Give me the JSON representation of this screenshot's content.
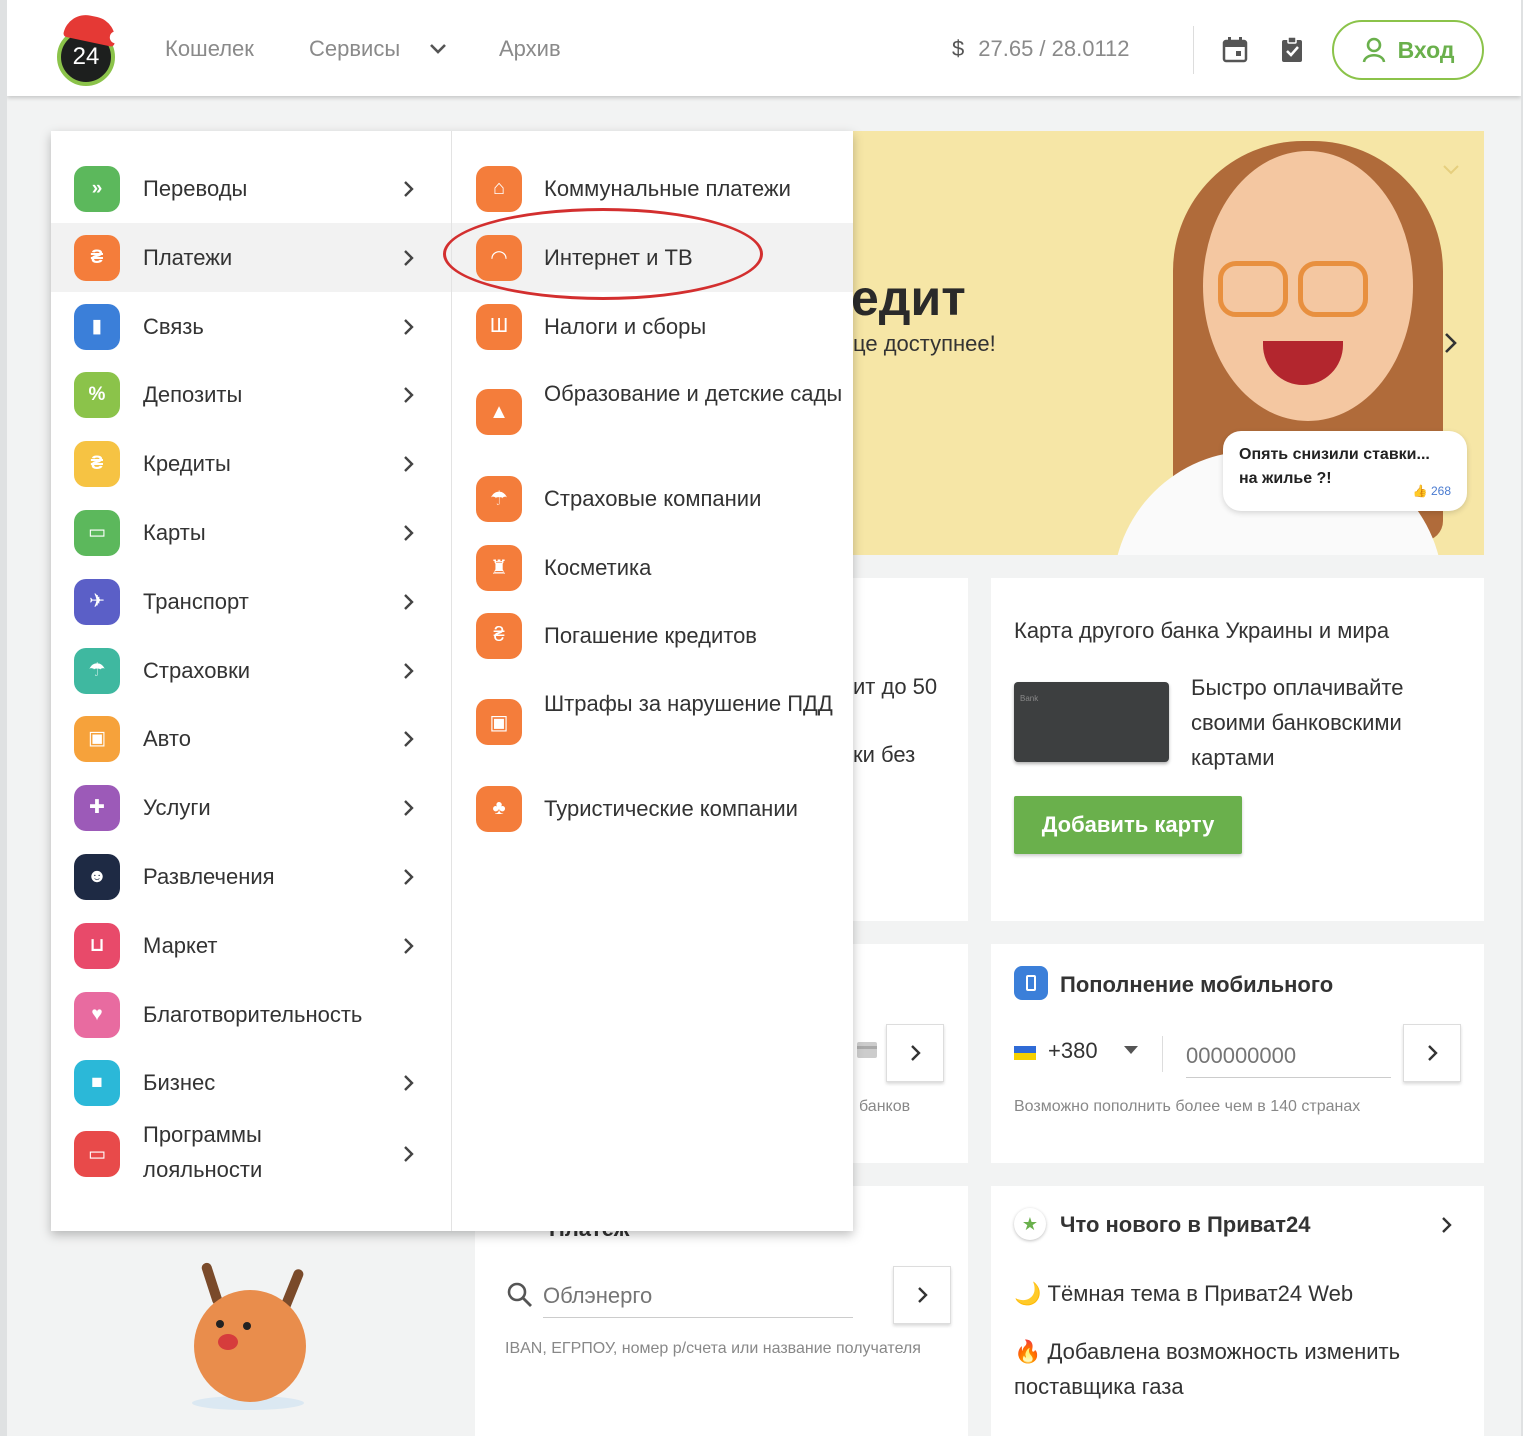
{
  "header": {
    "logo_text": "24",
    "nav": [
      {
        "label": "Кошелек"
      },
      {
        "label": "Сервисы"
      },
      {
        "label": "Архив"
      }
    ],
    "rate_symbol": "$",
    "rate": "27.65 / 28.0112",
    "login_label": "Вход"
  },
  "menu": {
    "items": [
      {
        "label": "Переводы",
        "icon": "double-chevron-icon",
        "glyph": "»",
        "color": "#5cb85c"
      },
      {
        "label": "Платежи",
        "icon": "hryvnia-icon",
        "glyph": "₴",
        "color": "#f47d3b"
      },
      {
        "label": "Связь",
        "icon": "signal-icon",
        "glyph": "▮",
        "color": "#3b7fd9"
      },
      {
        "label": "Депозиты",
        "icon": "percent-icon",
        "glyph": "%",
        "color": "#8bc34a"
      },
      {
        "label": "Кредиты",
        "icon": "money-bag-icon",
        "glyph": "₴",
        "color": "#f6c343"
      },
      {
        "label": "Карты",
        "icon": "card-icon",
        "glyph": "▭",
        "color": "#5cb85c"
      },
      {
        "label": "Транспорт",
        "icon": "plane-icon",
        "glyph": "✈",
        "color": "#5b5fc7"
      },
      {
        "label": "Страховки",
        "icon": "umbrella-icon",
        "glyph": "☂",
        "color": "#3fb8a0"
      },
      {
        "label": "Авто",
        "icon": "car-icon",
        "glyph": "▣",
        "color": "#f6a23b"
      },
      {
        "label": "Услуги",
        "icon": "puzzle-icon",
        "glyph": "✚",
        "color": "#9c5ab8"
      },
      {
        "label": "Развлечения",
        "icon": "smiley-icon",
        "glyph": "☻",
        "color": "#1e2a44"
      },
      {
        "label": "Маркет",
        "icon": "cart-icon",
        "glyph": "⊔",
        "color": "#e84a6a"
      },
      {
        "label": "Благотворительность",
        "icon": "heart-icon",
        "glyph": "♥",
        "color": "#e86ba0"
      },
      {
        "label": "Бизнес",
        "icon": "briefcase-icon",
        "glyph": "■",
        "color": "#2bb8d8"
      },
      {
        "label": "Программы лояльности",
        "icon": "wallet-icon",
        "glyph": "▭",
        "color": "#e84a4a"
      }
    ],
    "submenu": [
      {
        "label": "Коммунальные платежи",
        "icon": "home-icon",
        "glyph": "⌂"
      },
      {
        "label": "Интернет и ТВ",
        "icon": "wifi-icon",
        "glyph": "◠"
      },
      {
        "label": "Налоги и сборы",
        "icon": "trident-icon",
        "glyph": "Ш"
      },
      {
        "label": "Образование и детские сады",
        "icon": "graduation-cap-icon",
        "glyph": "▲"
      },
      {
        "label": "Страховые компании",
        "icon": "umbrella-icon",
        "glyph": "☂"
      },
      {
        "label": "Косметика",
        "icon": "cosmetics-icon",
        "glyph": "♜"
      },
      {
        "label": "Погашение кредитов",
        "icon": "money-bag-icon",
        "glyph": "₴"
      },
      {
        "label": "Штрафы за нарушение ПДД",
        "icon": "id-badge-icon",
        "glyph": "▣"
      },
      {
        "label": "Туристические компании",
        "icon": "palm-tree-icon",
        "glyph": "♣"
      }
    ]
  },
  "banner": {
    "title_partial": "едит",
    "subtitle_partial": "це доступнее!",
    "bubble_text": "Опять снизили ставки... на жилье ?!",
    "bubble_count": "268"
  },
  "cards": {
    "other_bank": {
      "title": "Карта другого банка Украины и мира",
      "card_text": "Bank",
      "description": "Быстро оплачивайте своими банковскими картами",
      "button": "Добавить карту"
    },
    "mobile": {
      "title": "Пополнение мобильного",
      "code": "+380",
      "placeholder": "000000000",
      "hint": "Возможно пополнить более чем в 140 странах"
    },
    "news": {
      "title": "Что нового в Приват24",
      "items": [
        {
          "emoji": "🌙",
          "text": "Тёмная тема в Приват24 Web"
        },
        {
          "emoji": "🔥",
          "text": "Добавлена возможность изменить поставщика газа"
        }
      ]
    },
    "credit_partial": {
      "line1": "ит до 50",
      "line2": "ки без"
    },
    "transfer_partial": {
      "hint": "банков"
    },
    "payment": {
      "title_partial": "Платеж",
      "placeholder": "Облэнерго",
      "hint": "IBAN, ЕГРПОУ, номер р/счета или название получателя"
    }
  }
}
